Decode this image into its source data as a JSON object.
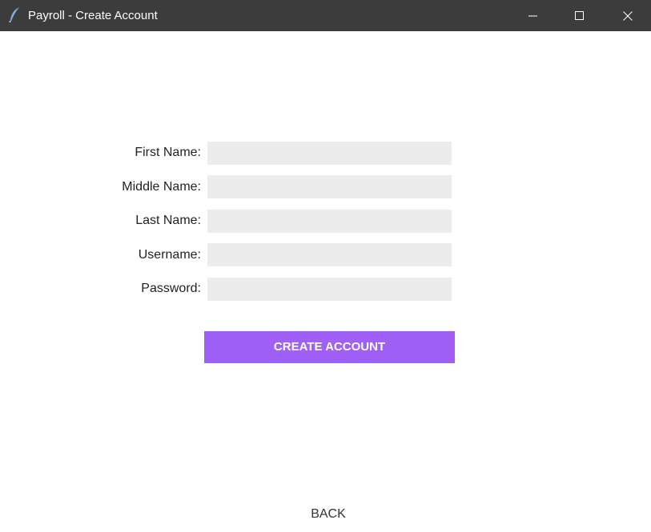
{
  "window": {
    "title": "Payroll - Create Account",
    "icon": "feather-icon",
    "controls": {
      "minimize_icon": "minimize-icon",
      "maximize_icon": "maximize-icon",
      "close_icon": "close-icon"
    },
    "titlebar_color": "#3c3c3c"
  },
  "form": {
    "fields": [
      {
        "label": "First Name:",
        "value": "",
        "placeholder": ""
      },
      {
        "label": "Middle Name:",
        "value": "",
        "placeholder": ""
      },
      {
        "label": "Last Name:",
        "value": "",
        "placeholder": ""
      },
      {
        "label": "Username:",
        "value": "",
        "placeholder": ""
      },
      {
        "label": "Password:",
        "value": "",
        "placeholder": ""
      }
    ],
    "input_background": "#ececec",
    "create_button_label": "CREATE ACCOUNT",
    "create_button_color": "#a060f5",
    "back_button_label": "BACK"
  }
}
